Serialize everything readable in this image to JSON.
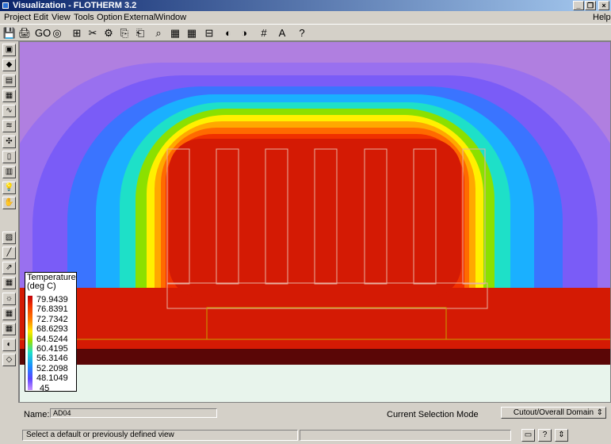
{
  "window": {
    "title": "Visualization - FLOTHERM 3.2",
    "min_label": "_",
    "restore_label": "❐",
    "close_label": "×"
  },
  "menus": [
    {
      "label": "Project",
      "key": "P"
    },
    {
      "label": "Edit",
      "key": "E"
    },
    {
      "label": "View",
      "key": "V"
    },
    {
      "label": "Tools",
      "key": "T"
    },
    {
      "label": "Option",
      "key": "O"
    },
    {
      "label": "External",
      "key": "x"
    },
    {
      "label": "Window",
      "key": "W"
    }
  ],
  "help_menu": "Help",
  "toolbar": {
    "icons": [
      "save-icon",
      "print-icon",
      "go-icon",
      "compass-icon",
      "split-object-icon",
      "cut-icon",
      "assembly-icon",
      "copy-icon",
      "paste-icon",
      "find-icon",
      "grid-objects-icon",
      "grid-objects-2-icon",
      "tree-icon",
      "view-up-icon",
      "view-down-icon",
      "grid-icon",
      "text-edit-icon",
      "help-pointer-icon"
    ],
    "glyphs": [
      "💾",
      "🖨",
      "GO",
      "◎",
      "⊞",
      "✂",
      "⚙",
      "⎘",
      "⎗",
      "⌕",
      "▦",
      "▦",
      "⊟",
      "◐",
      "◑",
      "#",
      "A",
      "?"
    ]
  },
  "side_toolbar": {
    "icons": [
      "plane-icon",
      "iso-icon",
      "gradient-icon",
      "surface-icon",
      "flow-icon",
      "particles-icon",
      "probe-icon",
      "monitor-icon",
      "table-icon",
      "lightbulb-icon",
      "hand-icon",
      "plot-icon",
      "graph-icon",
      "arrows-icon",
      "calculator-icon",
      "rainbow-icon",
      "mesh-icon",
      "grid3d-icon",
      "curve-icon",
      "diamond-icon"
    ],
    "glyphs": [
      "▣",
      "◆",
      "▤",
      "▦",
      "∿",
      "≋",
      "✣",
      "▯",
      "▥",
      "💡",
      "✋",
      "▨",
      "╱",
      "⇗",
      "▦",
      "☼",
      "▦",
      "▦",
      "◐",
      "◇"
    ]
  },
  "legend": {
    "title": "Temperature",
    "unit": "(deg C)",
    "values": [
      "79.9439",
      "76.8391",
      "72.7342",
      "68.6293",
      "64.5244",
      "60.4195",
      "56.3146",
      "52.2098",
      "48.1049",
      "45"
    ]
  },
  "fields": {
    "name_label": "Name:",
    "name_value": "AD04",
    "mode_label": "Current Selection Mode",
    "mode_value": "Cutout/Overall Domain",
    "mode_arrow": "⇕"
  },
  "status": {
    "message": "Select a default or previously defined view",
    "icons": [
      "keyboard-icon",
      "help-icon",
      "spinner-icon"
    ],
    "glyphs": [
      "▭",
      "?",
      "⇕"
    ]
  },
  "colors": {
    "background": "#b07fe0",
    "hot": "#d41a04",
    "board": "#5a0606",
    "ambient": "#e8f4ec"
  }
}
